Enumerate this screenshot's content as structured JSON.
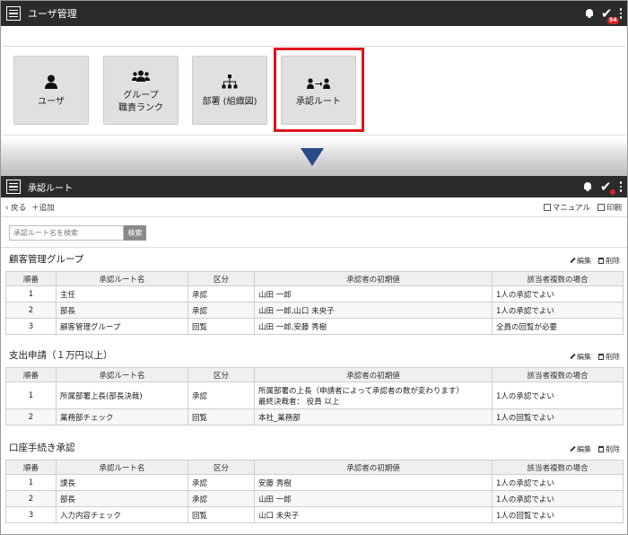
{
  "top_app": {
    "title": "ユーザ管理",
    "badge": "54"
  },
  "tiles": [
    {
      "label1": "ユーザ",
      "label2": ""
    },
    {
      "label1": "グループ",
      "label2": "職責ランク"
    },
    {
      "label1": "部署 (組織図)",
      "label2": ""
    },
    {
      "label1": "承認ルート",
      "label2": ""
    }
  ],
  "screen2": {
    "title": "承認ルート"
  },
  "subnav": {
    "back": "戻る",
    "add": "追加",
    "manual": "マニュアル",
    "print": "印刷"
  },
  "search": {
    "placeholder": "承認ルート名を検索",
    "button": "検索"
  },
  "columns": {
    "no": "順番",
    "name": "承認ルート名",
    "type": "区分",
    "approver": "承認者の初期値",
    "multi": "該当者複数の場合"
  },
  "actions": {
    "edit": "編集",
    "delete": "削除"
  },
  "groups": [
    {
      "title": "顧客管理グループ",
      "rows": [
        {
          "no": "1",
          "name": "主任",
          "type": "承認",
          "approver": "山田 一郎",
          "multi": "1人の承認でよい"
        },
        {
          "no": "2",
          "name": "部長",
          "type": "承認",
          "approver": "山田 一郎,山口 未央子",
          "multi": "1人の承認でよい"
        },
        {
          "no": "3",
          "name": "顧客管理グループ",
          "type": "回覧",
          "approver": "山田 一郎,安藤 秀樹",
          "multi": "全員の回覧が必要"
        }
      ]
    },
    {
      "title": "支出申請（１万円以上）",
      "rows": [
        {
          "no": "1",
          "name": "所属部署上長(部長決裁)",
          "type": "承認",
          "approver": "所属部署の上長（申請者によって承認者の数が変わります）",
          "approver2": "最終決裁者： 役員 以上",
          "multi": "1人の承認でよい"
        },
        {
          "no": "2",
          "name": "業務部チェック",
          "type": "回覧",
          "approver": "本社_業務部",
          "multi": "1人の回覧でよい"
        }
      ]
    },
    {
      "title": "口座手続き承認",
      "rows": [
        {
          "no": "1",
          "name": "課長",
          "type": "承認",
          "approver": "安藤 秀樹",
          "multi": "1人の承認でよい"
        },
        {
          "no": "2",
          "name": "部長",
          "type": "承認",
          "approver": "山田 一郎",
          "multi": "1人の承認でよい"
        },
        {
          "no": "3",
          "name": "入力内容チェック",
          "type": "回覧",
          "approver": "山口 未央子",
          "multi": "1人の回覧でよい"
        }
      ]
    }
  ]
}
